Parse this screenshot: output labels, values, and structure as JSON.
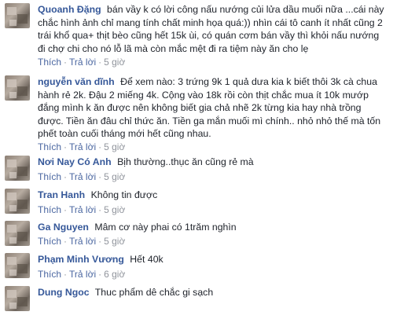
{
  "labels": {
    "like": "Thích",
    "reply": "Trả lời",
    "separator": "·"
  },
  "comments": [
    {
      "name": "Quoanh Đặng",
      "text": "bán vầy k có lời công nấu nướng củi lửa dầu muối nữa ...cái này chắc hình ảnh chỉ mang tính chất minh họa quá:)) nhìn cái tô canh ít nhất cũng 2 trái khổ qua+ thịt bèo cũng hết 15k ùi, có quán cơm bán vầy thì khỏi nấu nướng đi chợ chi cho nó lỗ lã mà còn mắc mệt đi ra tiệm này ăn cho lẹ",
      "time": "5 giờ"
    },
    {
      "name": "nguyễn văn dĩnh",
      "text": "Để xem nào: 3 trứng 9k 1 quả dưa kia k biết thôi 3k cà chua hành rẻ 2k. Đậu 2 miếng 4k. Cộng vào 18k rồi còn thịt chắc mua ít 10k mướp đắng mình k ăn được nên không biết gia chả nhẽ 2k từng kia hay nhà trồng được. Tiền ăn đâu chỉ thức ăn. Tiền ga mắn muối mì chính.. nhỏ nhỏ thế mà tốn phết toàn cuối tháng mới hết cũng nhau.",
      "time": "5 giờ"
    },
    {
      "name": "Nơi Nay Có Anh",
      "text": "Bịh thường..thục ăn cũng rẻ mà",
      "time": "5 giờ"
    },
    {
      "name": "Tran Hanh",
      "text": "Không tin được",
      "time": "5 giờ"
    },
    {
      "name": "Ga Nguyen",
      "text": "Mâm cơ này phai có 1trăm nghìn",
      "time": "5 giờ"
    },
    {
      "name": "Phạm Minh Vương",
      "text": "Hết 40k",
      "time": "6 giờ"
    },
    {
      "name": "Dung Ngoc",
      "text": "Thuc phẩm dê chắc gi sạch",
      "time": ""
    }
  ]
}
